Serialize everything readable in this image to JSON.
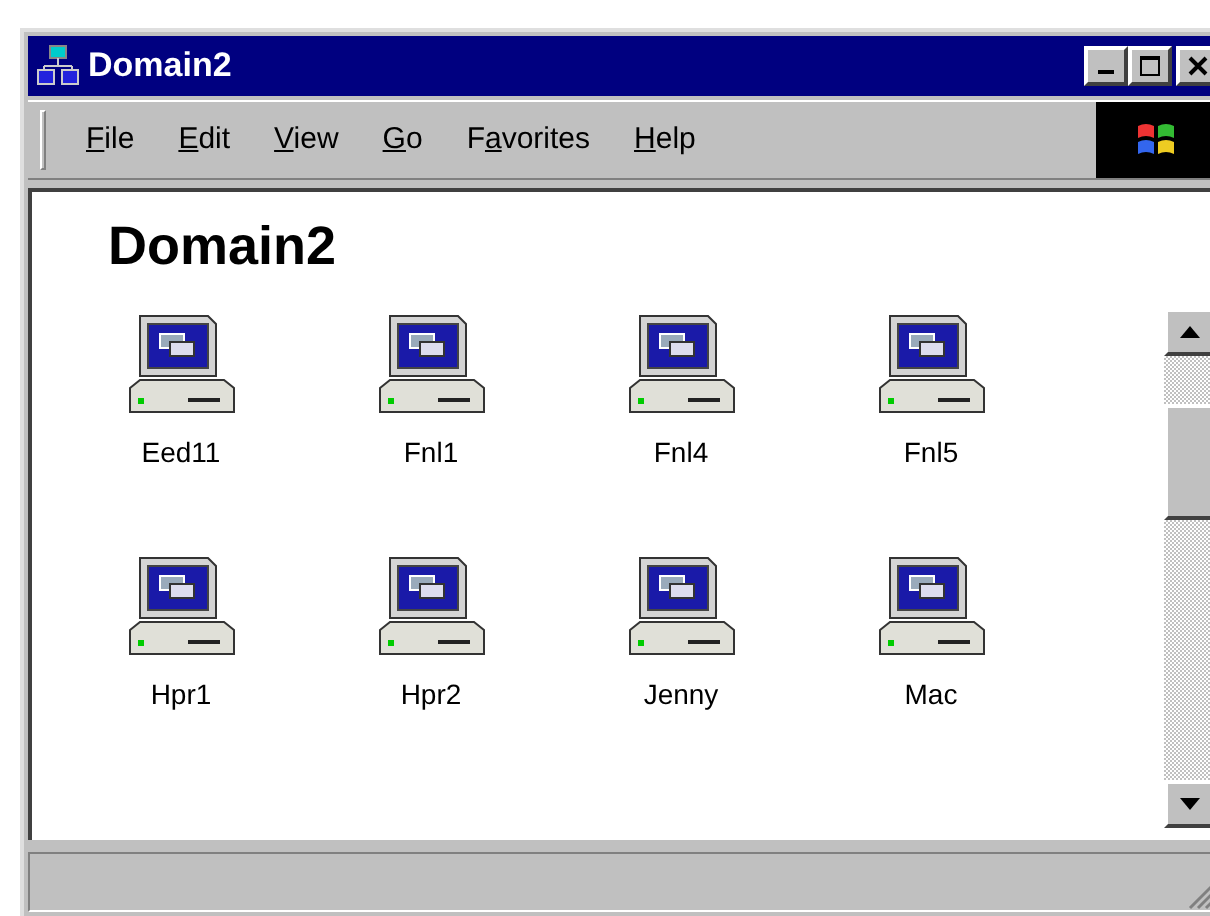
{
  "window": {
    "title": "Domain2"
  },
  "menu": [
    {
      "key": "F",
      "after": "ile"
    },
    {
      "key": "E",
      "after": "dit"
    },
    {
      "key": "V",
      "after": "iew"
    },
    {
      "key": "G",
      "after": "o"
    },
    {
      "before": "F",
      "key": "a",
      "after": "vorites"
    },
    {
      "key": "H",
      "after": "elp"
    }
  ],
  "heading": "Domain2",
  "computers": [
    {
      "label": "Eed11"
    },
    {
      "label": "Fnl1"
    },
    {
      "label": "Fnl4"
    },
    {
      "label": "Fnl5"
    },
    {
      "label": "Hpr1"
    },
    {
      "label": "Hpr2"
    },
    {
      "label": "Jenny"
    },
    {
      "label": "Mac"
    }
  ]
}
